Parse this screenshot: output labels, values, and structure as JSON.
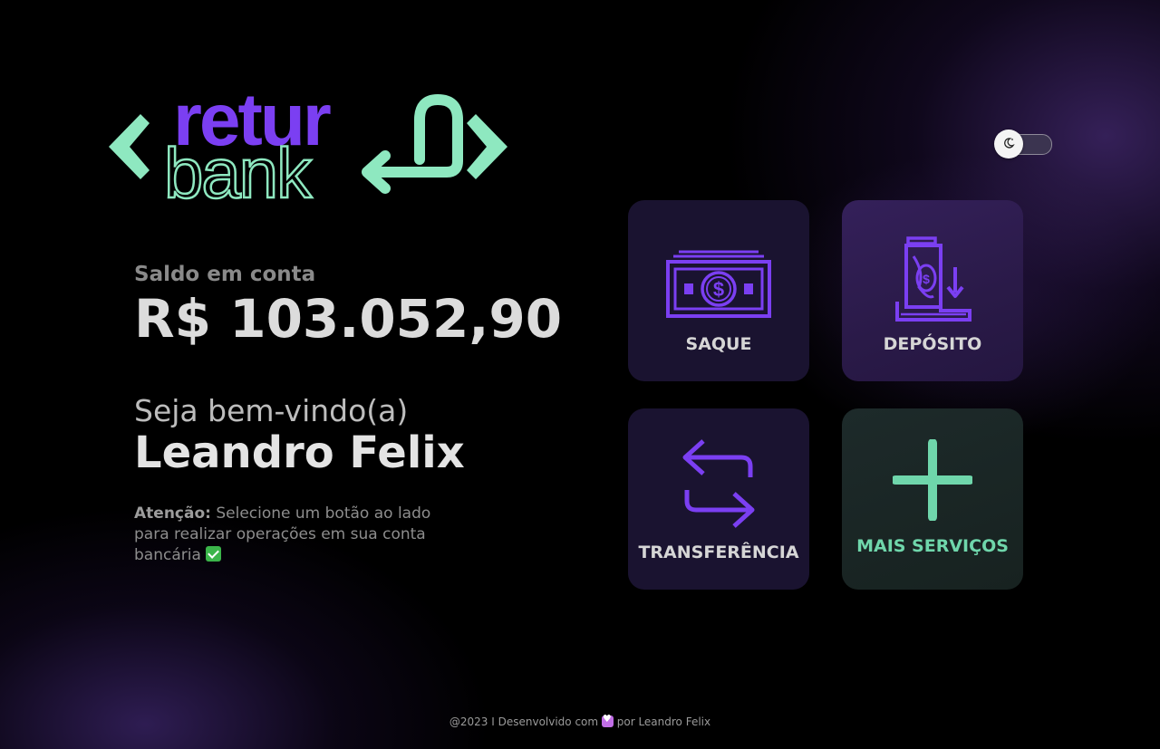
{
  "logo": {
    "word_top": "retur",
    "word_bottom": "bank",
    "colors": {
      "purple": "#7b3ff2",
      "mint": "#8ee8c0"
    }
  },
  "theme_toggle": {
    "icon": "moon-icon",
    "state": "off"
  },
  "balance": {
    "label": "Saldo em conta",
    "value": "R$ 103.052,90"
  },
  "welcome": {
    "greeting": "Seja bem-vindo(a)",
    "name": "Leandro Felix"
  },
  "attention": {
    "title": "Atenção:",
    "message": "Selecione um botão ao lado para realizar operações em sua conta bancária"
  },
  "actions": [
    {
      "label": "SAQUE",
      "icon": "cash-icon"
    },
    {
      "label": "DEPÓSITO",
      "icon": "deposit-icon"
    },
    {
      "label": "TRANSFERÊNCIA",
      "icon": "transfer-arrows-icon"
    },
    {
      "label": "MAIS SERVIÇOS",
      "icon": "plus-icon"
    }
  ],
  "footer": {
    "prefix": "@2023 I Desenvolvido com",
    "suffix": "por Leandro Felix"
  },
  "colors": {
    "accent_purple": "#7b3ff2",
    "accent_mint": "#6fd6ab",
    "card_dark": "#1a1330"
  }
}
